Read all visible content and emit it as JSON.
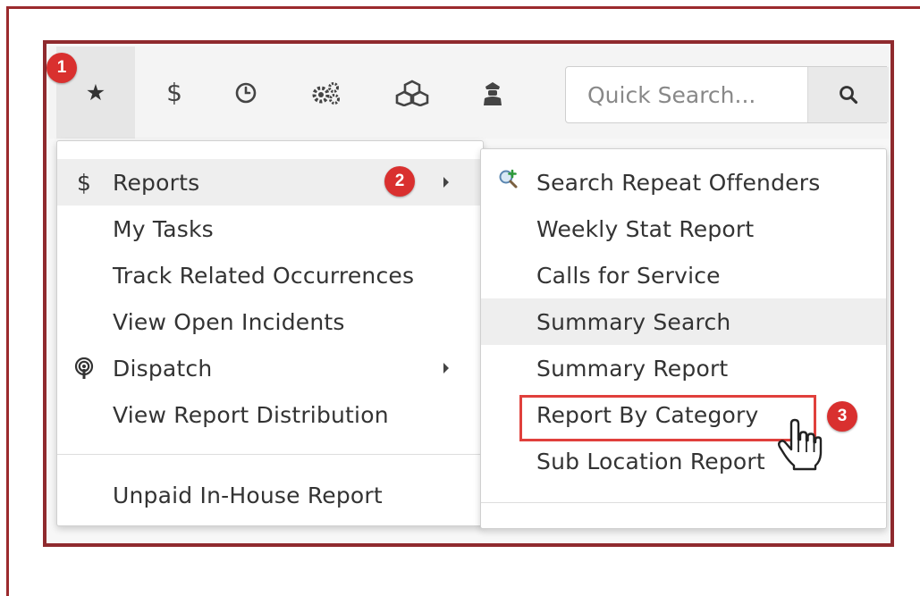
{
  "toolbar": {
    "icons": [
      "star-icon",
      "dollar-icon",
      "clock-icon",
      "gears-icon",
      "cubes-icon",
      "officer-icon"
    ],
    "star_glyph": "★",
    "dollar_glyph": "$",
    "search_placeholder": "Quick Search..."
  },
  "badges": {
    "one": "1",
    "two": "2",
    "three": "3"
  },
  "menu_left": {
    "items": [
      {
        "label": "Reports",
        "icon": "$",
        "submenu": true,
        "highlighted": true
      },
      {
        "label": "My Tasks"
      },
      {
        "label": "Track Related Occurrences"
      },
      {
        "label": "View Open Incidents"
      },
      {
        "label": "Dispatch",
        "icon": "podcast-icon",
        "submenu": true
      },
      {
        "label": "View Report Distribution"
      },
      {
        "label": "Unpaid In-House Report"
      }
    ]
  },
  "menu_right": {
    "items": [
      {
        "label": "Search Repeat Offenders",
        "icon": "search-plus-icon"
      },
      {
        "label": "Weekly Stat Report"
      },
      {
        "label": "Calls for Service"
      },
      {
        "label": "Summary Search",
        "highlighted": true
      },
      {
        "label": "Summary Report"
      },
      {
        "label": "Report By Category",
        "callout": true
      },
      {
        "label": "Sub Location Report"
      }
    ]
  },
  "colors": {
    "frame": "#8f2a2e",
    "badge": "#d9302f",
    "callout_border": "#e0403c",
    "hover_bg": "#eeeeee"
  }
}
